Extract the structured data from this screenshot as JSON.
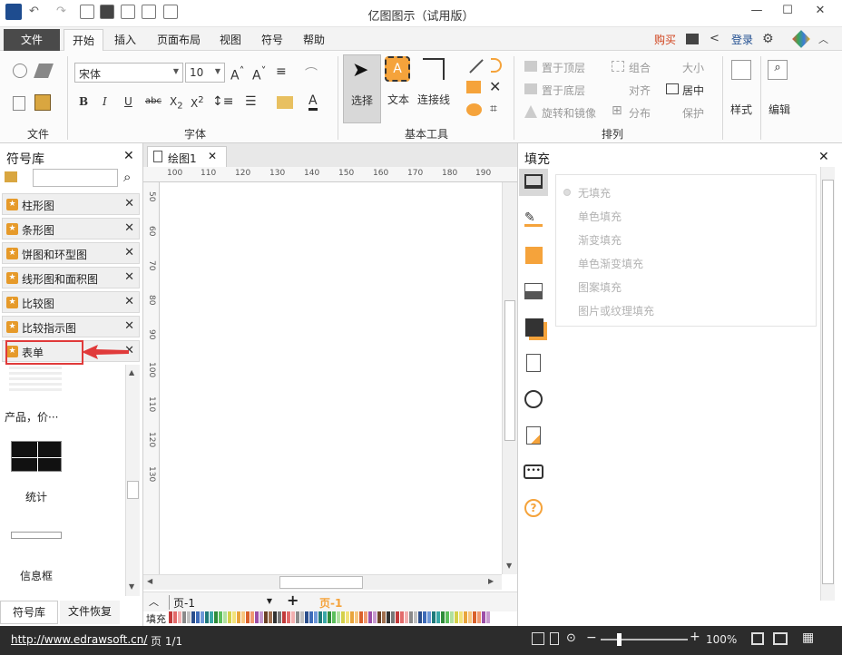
{
  "app": {
    "title": "亿图图示（试用版）"
  },
  "menubar": {
    "file": "文件",
    "tabs": [
      "开始",
      "插入",
      "页面布局",
      "视图",
      "符号",
      "帮助"
    ],
    "buy": "购买",
    "login": "登录"
  },
  "ribbon": {
    "groups": {
      "file": "文件",
      "font": "字体",
      "basic_tools": "基本工具",
      "arrange": "排列"
    },
    "font_name": "宋体",
    "font_size": "10",
    "tools": {
      "select": "选择",
      "text": "文本",
      "connector": "连接线"
    },
    "arrange": {
      "bring_front": "置于顶层",
      "send_back": "置于底层",
      "rotate_mirror": "旋转和镜像",
      "group": "组合",
      "align": "对齐",
      "distribute": "分布",
      "size": "大小",
      "center": "居中",
      "protect": "保护"
    },
    "style": "样式",
    "edit": "编辑"
  },
  "left_panel": {
    "title": "符号库",
    "libraries": [
      "柱形图",
      "条形图",
      "饼图和环型图",
      "线形图和面积图",
      "比较图",
      "比较指示图",
      "表单"
    ],
    "shapes": [
      "产品，价···",
      "统计",
      "信息框"
    ],
    "bottom_tabs": [
      "符号库",
      "文件恢复"
    ]
  },
  "canvas": {
    "tab": "绘图1",
    "ruler_h": [
      "100",
      "110",
      "120",
      "130",
      "140",
      "150",
      "160",
      "170",
      "180",
      "190"
    ],
    "ruler_v": [
      "50",
      "60",
      "70",
      "80",
      "90",
      "100",
      "110",
      "120",
      "130"
    ]
  },
  "page_bar": {
    "page_select": "页-1",
    "current": "页-1",
    "fill_label": "填充"
  },
  "right_panel": {
    "title": "填充",
    "options": [
      "无填充",
      "单色填充",
      "渐变填充",
      "单色渐变填充",
      "图案填充",
      "图片或纹理填充"
    ]
  },
  "status": {
    "url": "http://www.edrawsoft.cn/",
    "page": "页 1/1",
    "zoom": "100%"
  },
  "colors": {
    "accent": "#2b579a",
    "annotation": "#e03a3a",
    "orange": "#f5a33b",
    "status_bg": "#2c2c2c"
  },
  "palette": [
    "#c23a3a",
    "#e26b6b",
    "#f2b0b0",
    "#8a8a8a",
    "#c0c0c0",
    "#2b4f8c",
    "#3d6bb8",
    "#6e98d8",
    "#1f7a7a",
    "#3aa7a7",
    "#2f8c3a",
    "#5cbf5c",
    "#b0e0a0",
    "#d4d04a",
    "#f2e27a",
    "#e8a43c",
    "#f7c680",
    "#d9602a",
    "#f09a70",
    "#9c4fa8",
    "#c79ad0",
    "#6b4226",
    "#a07050",
    "#333333",
    "#777777"
  ]
}
